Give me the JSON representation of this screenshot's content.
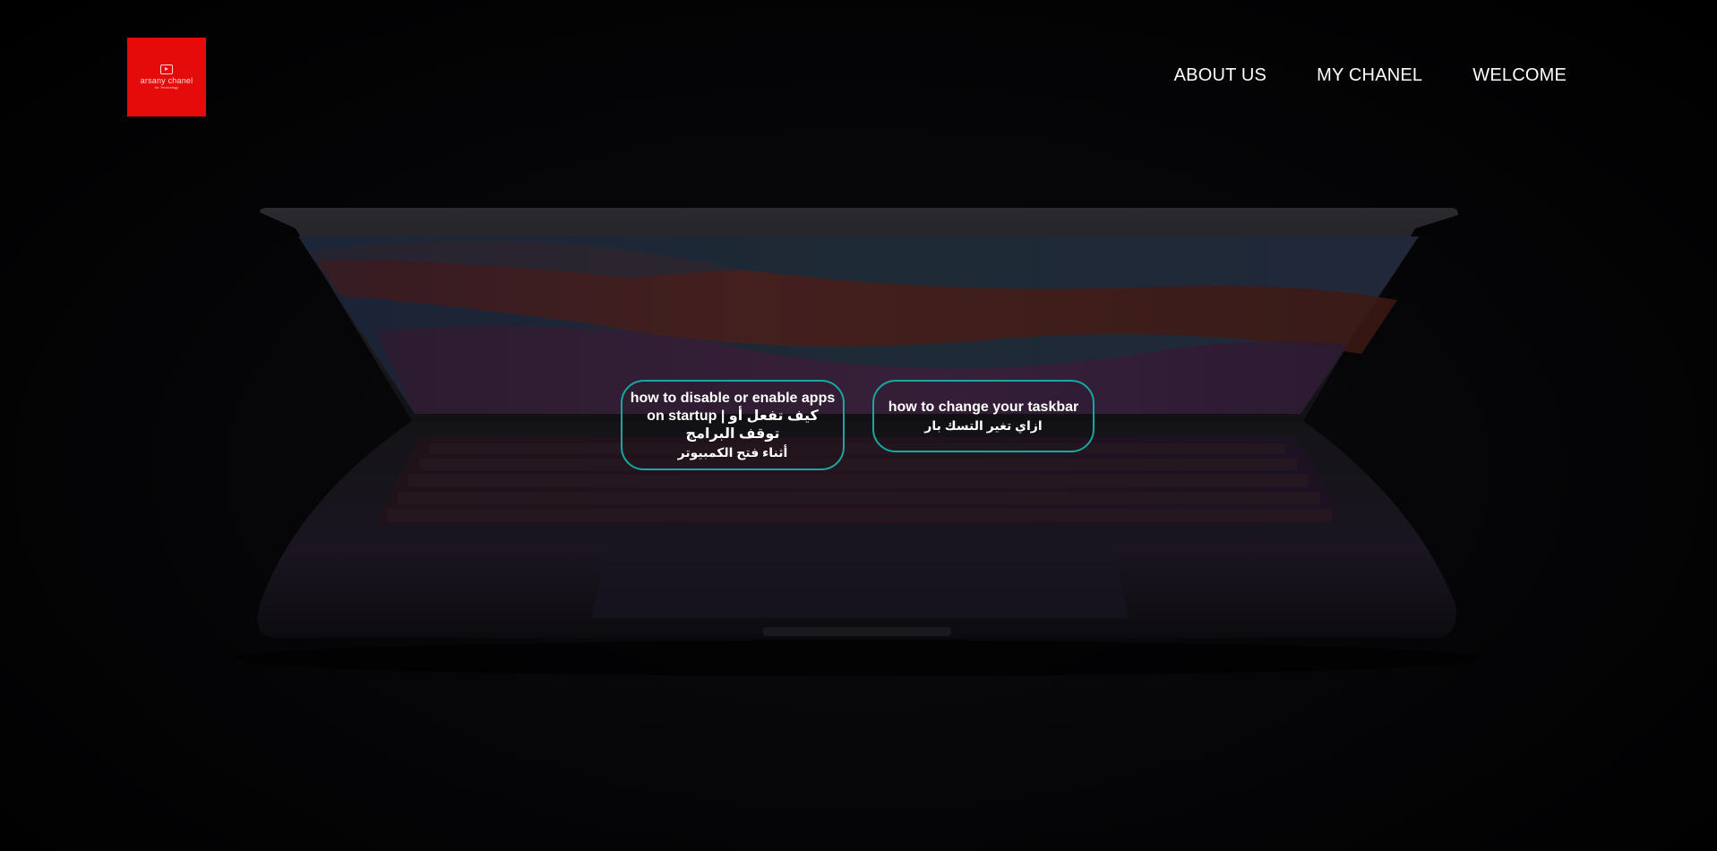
{
  "header": {
    "logo": {
      "title": "arsany chanel",
      "tagline": "for Technology",
      "icon": "youtube-play-icon",
      "color": "#e50b0b"
    },
    "nav": [
      {
        "label": "ABOUT US"
      },
      {
        "label": "MY CHANEL"
      },
      {
        "label": "WELCOME"
      }
    ]
  },
  "cards": [
    {
      "title_line1": "how to disable or enable apps",
      "title_line2": "on startup | كيف تفعل أو توقف البرامج",
      "title_line3": "أثناء فتح الكمبيوتر"
    },
    {
      "title_line1": "how to change your taskbar",
      "title_line2": "ازاي تغير التسك بار"
    }
  ],
  "colors": {
    "card_border": "#17a8a0",
    "background": "#000000",
    "text": "#ffffff"
  }
}
